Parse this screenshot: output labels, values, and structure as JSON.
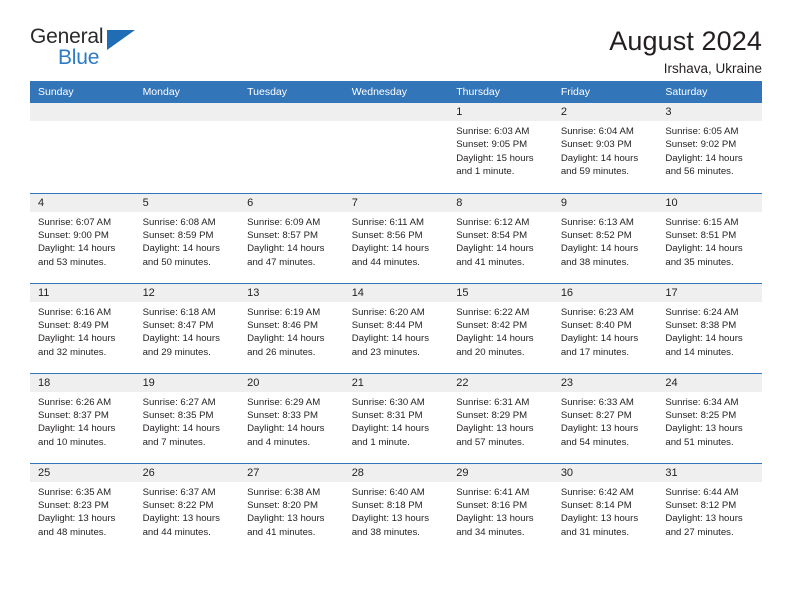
{
  "brand": {
    "name_top": "General",
    "name_bottom": "Blue",
    "triangle_color": "#1f6db5",
    "blue_color": "#2e7bc4"
  },
  "header": {
    "title": "August 2024",
    "subtitle": "Irshava, Ukraine",
    "header_bg": "#3275b9",
    "daynum_bg": "#efefef"
  },
  "weekday_headers": [
    "Sunday",
    "Monday",
    "Tuesday",
    "Wednesday",
    "Thursday",
    "Friday",
    "Saturday"
  ],
  "weeks": [
    [
      {
        "day": "",
        "sunrise": "",
        "sunset": "",
        "daylight": "",
        "daylight2": "",
        "empty": true
      },
      {
        "day": "",
        "sunrise": "",
        "sunset": "",
        "daylight": "",
        "daylight2": "",
        "empty": true
      },
      {
        "day": "",
        "sunrise": "",
        "sunset": "",
        "daylight": "",
        "daylight2": "",
        "empty": true
      },
      {
        "day": "",
        "sunrise": "",
        "sunset": "",
        "daylight": "",
        "daylight2": "",
        "empty": true
      },
      {
        "day": "1",
        "sunrise": "Sunrise: 6:03 AM",
        "sunset": "Sunset: 9:05 PM",
        "daylight": "Daylight: 15 hours",
        "daylight2": "and 1 minute."
      },
      {
        "day": "2",
        "sunrise": "Sunrise: 6:04 AM",
        "sunset": "Sunset: 9:03 PM",
        "daylight": "Daylight: 14 hours",
        "daylight2": "and 59 minutes."
      },
      {
        "day": "3",
        "sunrise": "Sunrise: 6:05 AM",
        "sunset": "Sunset: 9:02 PM",
        "daylight": "Daylight: 14 hours",
        "daylight2": "and 56 minutes."
      }
    ],
    [
      {
        "day": "4",
        "sunrise": "Sunrise: 6:07 AM",
        "sunset": "Sunset: 9:00 PM",
        "daylight": "Daylight: 14 hours",
        "daylight2": "and 53 minutes."
      },
      {
        "day": "5",
        "sunrise": "Sunrise: 6:08 AM",
        "sunset": "Sunset: 8:59 PM",
        "daylight": "Daylight: 14 hours",
        "daylight2": "and 50 minutes."
      },
      {
        "day": "6",
        "sunrise": "Sunrise: 6:09 AM",
        "sunset": "Sunset: 8:57 PM",
        "daylight": "Daylight: 14 hours",
        "daylight2": "and 47 minutes."
      },
      {
        "day": "7",
        "sunrise": "Sunrise: 6:11 AM",
        "sunset": "Sunset: 8:56 PM",
        "daylight": "Daylight: 14 hours",
        "daylight2": "and 44 minutes."
      },
      {
        "day": "8",
        "sunrise": "Sunrise: 6:12 AM",
        "sunset": "Sunset: 8:54 PM",
        "daylight": "Daylight: 14 hours",
        "daylight2": "and 41 minutes."
      },
      {
        "day": "9",
        "sunrise": "Sunrise: 6:13 AM",
        "sunset": "Sunset: 8:52 PM",
        "daylight": "Daylight: 14 hours",
        "daylight2": "and 38 minutes."
      },
      {
        "day": "10",
        "sunrise": "Sunrise: 6:15 AM",
        "sunset": "Sunset: 8:51 PM",
        "daylight": "Daylight: 14 hours",
        "daylight2": "and 35 minutes."
      }
    ],
    [
      {
        "day": "11",
        "sunrise": "Sunrise: 6:16 AM",
        "sunset": "Sunset: 8:49 PM",
        "daylight": "Daylight: 14 hours",
        "daylight2": "and 32 minutes."
      },
      {
        "day": "12",
        "sunrise": "Sunrise: 6:18 AM",
        "sunset": "Sunset: 8:47 PM",
        "daylight": "Daylight: 14 hours",
        "daylight2": "and 29 minutes."
      },
      {
        "day": "13",
        "sunrise": "Sunrise: 6:19 AM",
        "sunset": "Sunset: 8:46 PM",
        "daylight": "Daylight: 14 hours",
        "daylight2": "and 26 minutes."
      },
      {
        "day": "14",
        "sunrise": "Sunrise: 6:20 AM",
        "sunset": "Sunset: 8:44 PM",
        "daylight": "Daylight: 14 hours",
        "daylight2": "and 23 minutes."
      },
      {
        "day": "15",
        "sunrise": "Sunrise: 6:22 AM",
        "sunset": "Sunset: 8:42 PM",
        "daylight": "Daylight: 14 hours",
        "daylight2": "and 20 minutes."
      },
      {
        "day": "16",
        "sunrise": "Sunrise: 6:23 AM",
        "sunset": "Sunset: 8:40 PM",
        "daylight": "Daylight: 14 hours",
        "daylight2": "and 17 minutes."
      },
      {
        "day": "17",
        "sunrise": "Sunrise: 6:24 AM",
        "sunset": "Sunset: 8:38 PM",
        "daylight": "Daylight: 14 hours",
        "daylight2": "and 14 minutes."
      }
    ],
    [
      {
        "day": "18",
        "sunrise": "Sunrise: 6:26 AM",
        "sunset": "Sunset: 8:37 PM",
        "daylight": "Daylight: 14 hours",
        "daylight2": "and 10 minutes."
      },
      {
        "day": "19",
        "sunrise": "Sunrise: 6:27 AM",
        "sunset": "Sunset: 8:35 PM",
        "daylight": "Daylight: 14 hours",
        "daylight2": "and 7 minutes."
      },
      {
        "day": "20",
        "sunrise": "Sunrise: 6:29 AM",
        "sunset": "Sunset: 8:33 PM",
        "daylight": "Daylight: 14 hours",
        "daylight2": "and 4 minutes."
      },
      {
        "day": "21",
        "sunrise": "Sunrise: 6:30 AM",
        "sunset": "Sunset: 8:31 PM",
        "daylight": "Daylight: 14 hours",
        "daylight2": "and 1 minute."
      },
      {
        "day": "22",
        "sunrise": "Sunrise: 6:31 AM",
        "sunset": "Sunset: 8:29 PM",
        "daylight": "Daylight: 13 hours",
        "daylight2": "and 57 minutes."
      },
      {
        "day": "23",
        "sunrise": "Sunrise: 6:33 AM",
        "sunset": "Sunset: 8:27 PM",
        "daylight": "Daylight: 13 hours",
        "daylight2": "and 54 minutes."
      },
      {
        "day": "24",
        "sunrise": "Sunrise: 6:34 AM",
        "sunset": "Sunset: 8:25 PM",
        "daylight": "Daylight: 13 hours",
        "daylight2": "and 51 minutes."
      }
    ],
    [
      {
        "day": "25",
        "sunrise": "Sunrise: 6:35 AM",
        "sunset": "Sunset: 8:23 PM",
        "daylight": "Daylight: 13 hours",
        "daylight2": "and 48 minutes."
      },
      {
        "day": "26",
        "sunrise": "Sunrise: 6:37 AM",
        "sunset": "Sunset: 8:22 PM",
        "daylight": "Daylight: 13 hours",
        "daylight2": "and 44 minutes."
      },
      {
        "day": "27",
        "sunrise": "Sunrise: 6:38 AM",
        "sunset": "Sunset: 8:20 PM",
        "daylight": "Daylight: 13 hours",
        "daylight2": "and 41 minutes."
      },
      {
        "day": "28",
        "sunrise": "Sunrise: 6:40 AM",
        "sunset": "Sunset: 8:18 PM",
        "daylight": "Daylight: 13 hours",
        "daylight2": "and 38 minutes."
      },
      {
        "day": "29",
        "sunrise": "Sunrise: 6:41 AM",
        "sunset": "Sunset: 8:16 PM",
        "daylight": "Daylight: 13 hours",
        "daylight2": "and 34 minutes."
      },
      {
        "day": "30",
        "sunrise": "Sunrise: 6:42 AM",
        "sunset": "Sunset: 8:14 PM",
        "daylight": "Daylight: 13 hours",
        "daylight2": "and 31 minutes."
      },
      {
        "day": "31",
        "sunrise": "Sunrise: 6:44 AM",
        "sunset": "Sunset: 8:12 PM",
        "daylight": "Daylight: 13 hours",
        "daylight2": "and 27 minutes."
      }
    ]
  ]
}
